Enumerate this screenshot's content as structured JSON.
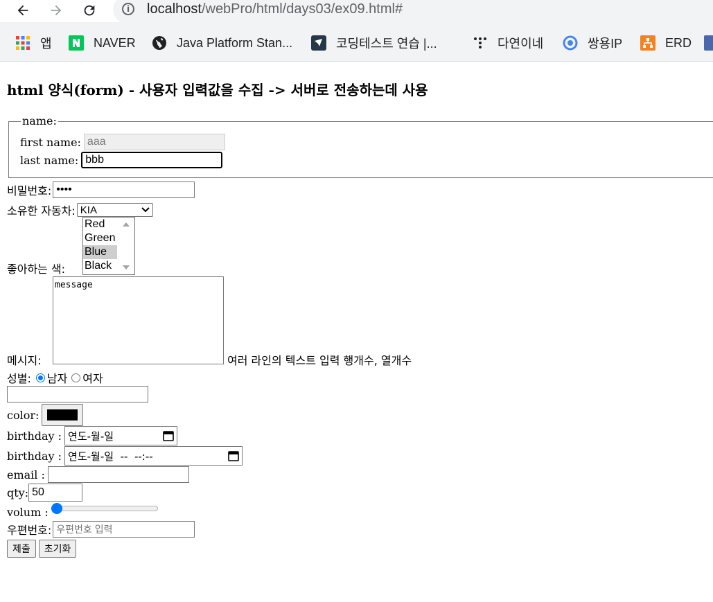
{
  "browser": {
    "url_host": "localhost",
    "url_path": "/webPro/html/days03/ex09.html#",
    "bookmarks": [
      {
        "icon": "apps-grid-icon",
        "label": "앱"
      },
      {
        "icon": "naver-logo-icon",
        "label": "NAVER"
      },
      {
        "icon": "globe-icon",
        "label": "Java Platform Stan..."
      },
      {
        "icon": "coding-test-icon",
        "label": "코딩테스트 연습 |..."
      },
      {
        "icon": "dots-icon",
        "label": "다연이네"
      },
      {
        "icon": "ip-icon",
        "label": "쌍용IP"
      },
      {
        "icon": "erd-icon",
        "label": "ERD"
      }
    ]
  },
  "page": {
    "title": "html 양식(form) - 사용자 입력값을 수집 -> 서버로 전송하는데 사용",
    "name_legend": "name:",
    "first_name_label": "first name:",
    "first_name_value": "aaa",
    "last_name_label": "last name:",
    "last_name_value": "bbb",
    "password_label": "비밀번호:",
    "password_value": "••••",
    "car_label": "소유한 자동차:",
    "car_selected": "KIA",
    "color_list_label": "좋아하는 색:",
    "color_options": [
      "Red",
      "Green",
      "Blue",
      "Black"
    ],
    "color_selected": "Blue",
    "message_label": "메시지:",
    "message_value": "message",
    "message_note": "여러 라인의 텍스트 입력 행개수, 열개수",
    "gender_label": "성별:",
    "gender_male": "남자",
    "gender_female": "여자",
    "gender_selected": "남자",
    "color_label": "color:",
    "color_value": "#000000",
    "birthday_label": "birthday :",
    "date_placeholder": "연도-월-일",
    "datetime_placeholder": "연도-월-일  --  --:--",
    "email_label": "email :",
    "qty_label": "qty:",
    "qty_value": "50",
    "volume_label": "volum :",
    "volume_value": 0,
    "zip_label": "우편번호:",
    "zip_placeholder": "우편번호 입력",
    "submit_label": "제출",
    "reset_label": "초기화"
  }
}
